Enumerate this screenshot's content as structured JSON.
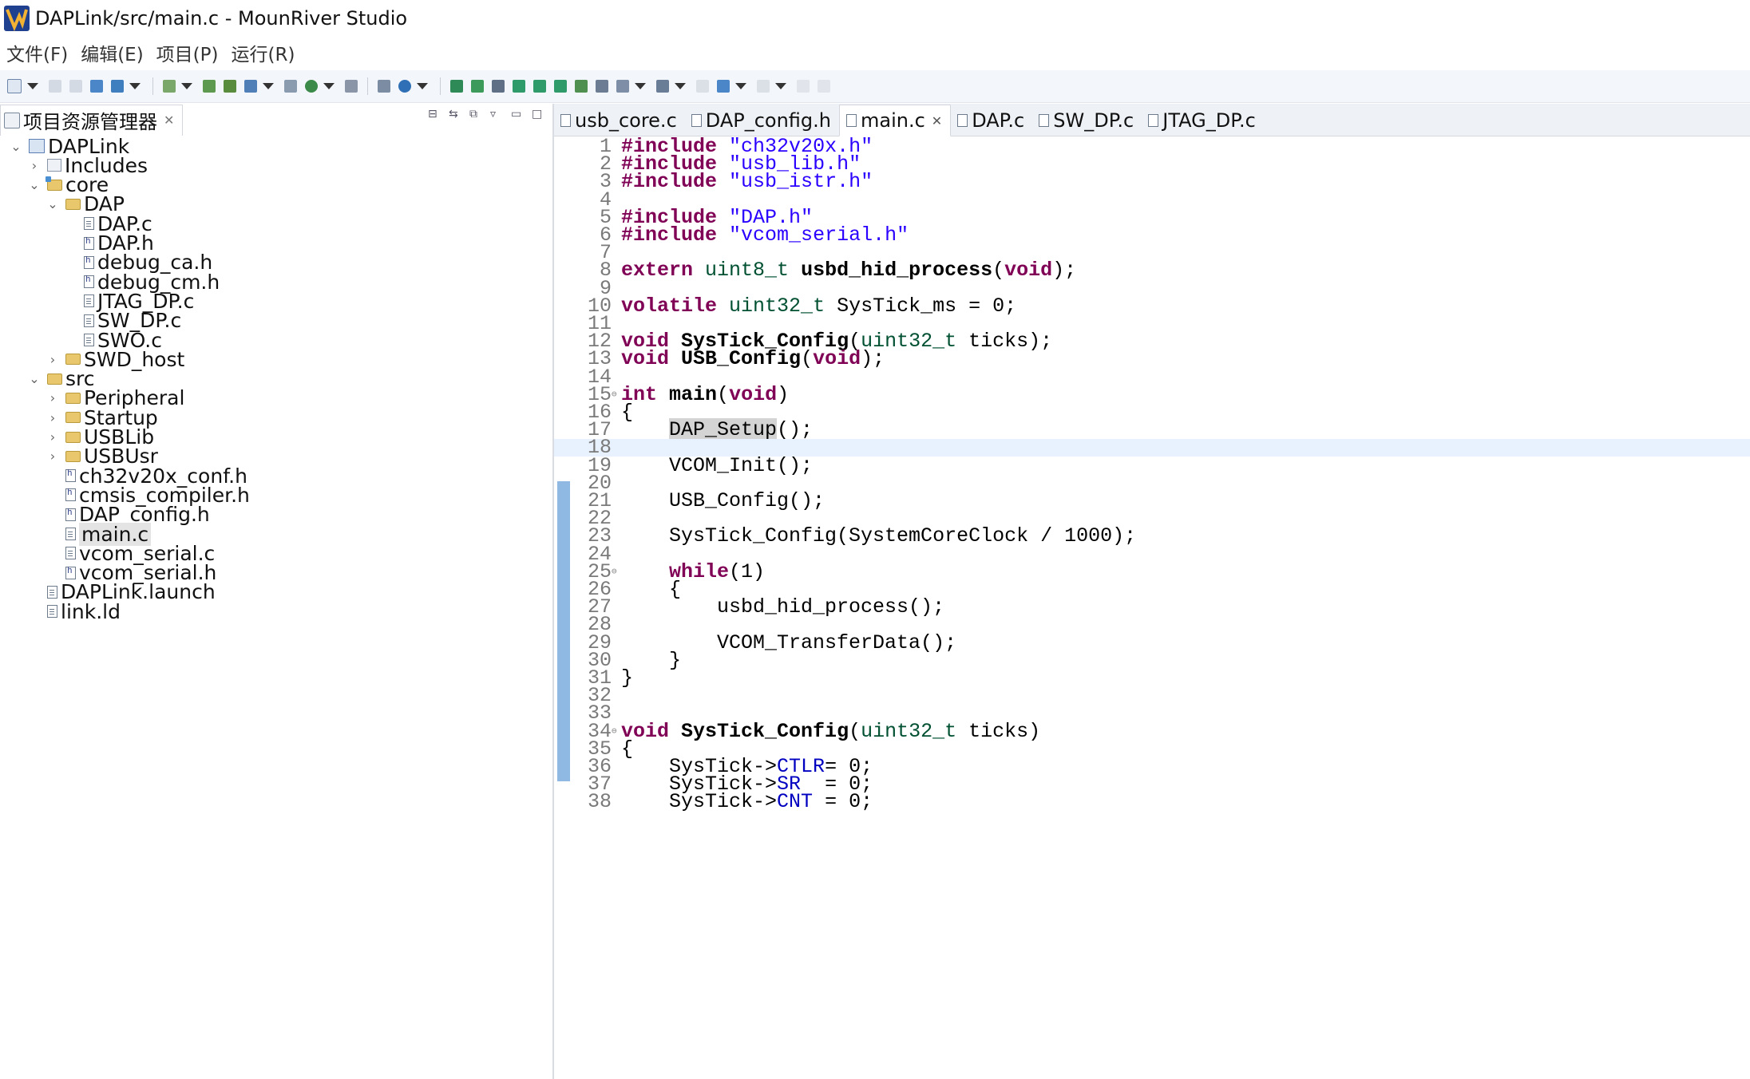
{
  "window": {
    "title": "DAPLink/src/main.c - MounRiver Studio"
  },
  "menu": [
    "文件(F)",
    "编辑(E)",
    "项目(P)",
    "运行(R)"
  ],
  "explorer": {
    "title": "项目资源管理器",
    "tree": [
      {
        "label": "DAPLink",
        "depth": 0,
        "twisty": "v",
        "icon": "project"
      },
      {
        "label": "Includes",
        "depth": 1,
        "twisty": ">",
        "icon": "include"
      },
      {
        "label": "core",
        "depth": 1,
        "twisty": "v",
        "icon": "srcfolder"
      },
      {
        "label": "DAP",
        "depth": 2,
        "twisty": "v",
        "icon": "folder"
      },
      {
        "label": "DAP.c",
        "depth": 3,
        "twisty": "",
        "icon": "file"
      },
      {
        "label": "DAP.h",
        "depth": 3,
        "twisty": "",
        "icon": "hfile"
      },
      {
        "label": "debug_ca.h",
        "depth": 3,
        "twisty": "",
        "icon": "hfile"
      },
      {
        "label": "debug_cm.h",
        "depth": 3,
        "twisty": "",
        "icon": "hfile"
      },
      {
        "label": "JTAG_DP.c",
        "depth": 3,
        "twisty": "",
        "icon": "file"
      },
      {
        "label": "SW_DP.c",
        "depth": 3,
        "twisty": "",
        "icon": "file"
      },
      {
        "label": "SWO.c",
        "depth": 3,
        "twisty": "",
        "icon": "file"
      },
      {
        "label": "SWD_host",
        "depth": 2,
        "twisty": ">",
        "icon": "folder"
      },
      {
        "label": "src",
        "depth": 1,
        "twisty": "v",
        "icon": "folder"
      },
      {
        "label": "Peripheral",
        "depth": 2,
        "twisty": ">",
        "icon": "folder"
      },
      {
        "label": "Startup",
        "depth": 2,
        "twisty": ">",
        "icon": "folder"
      },
      {
        "label": "USBLib",
        "depth": 2,
        "twisty": ">",
        "icon": "folder"
      },
      {
        "label": "USBUsr",
        "depth": 2,
        "twisty": ">",
        "icon": "folder"
      },
      {
        "label": "ch32v20x_conf.h",
        "depth": 2,
        "twisty": "",
        "icon": "hfile"
      },
      {
        "label": "cmsis_compiler.h",
        "depth": 2,
        "twisty": "",
        "icon": "hfile"
      },
      {
        "label": "DAP_config.h",
        "depth": 2,
        "twisty": "",
        "icon": "hfile"
      },
      {
        "label": "main.c",
        "depth": 2,
        "twisty": "",
        "icon": "file",
        "selected": true
      },
      {
        "label": "vcom_serial.c",
        "depth": 2,
        "twisty": "",
        "icon": "file"
      },
      {
        "label": "vcom_serial.h",
        "depth": 2,
        "twisty": "",
        "icon": "hfile"
      },
      {
        "label": "DAPLink.launch",
        "depth": 1,
        "twisty": "",
        "icon": "file"
      },
      {
        "label": "link.ld",
        "depth": 1,
        "twisty": "",
        "icon": "file"
      }
    ]
  },
  "editor": {
    "tabs": [
      {
        "label": "usb_core.c",
        "active": false
      },
      {
        "label": "DAP_config.h",
        "active": false
      },
      {
        "label": "main.c",
        "active": true
      },
      {
        "label": "DAP.c",
        "active": false
      },
      {
        "label": "SW_DP.c",
        "active": false
      },
      {
        "label": "JTAG_DP.c",
        "active": false
      }
    ],
    "current_line": 18,
    "lines": [
      [
        [
          "kw",
          "#include"
        ],
        [
          "t",
          " "
        ],
        [
          "str",
          "\"ch32v20x.h\""
        ]
      ],
      [
        [
          "kw",
          "#include"
        ],
        [
          "t",
          " "
        ],
        [
          "str",
          "\"usb_lib.h\""
        ]
      ],
      [
        [
          "kw",
          "#include"
        ],
        [
          "t",
          " "
        ],
        [
          "str",
          "\"usb_istr.h\""
        ]
      ],
      [],
      [
        [
          "kw",
          "#include"
        ],
        [
          "t",
          " "
        ],
        [
          "str",
          "\"DAP.h\""
        ]
      ],
      [
        [
          "kw",
          "#include"
        ],
        [
          "t",
          " "
        ],
        [
          "str",
          "\"vcom_serial.h\""
        ]
      ],
      [],
      [
        [
          "kw",
          "extern"
        ],
        [
          "t",
          " "
        ],
        [
          "type",
          "uint8_t"
        ],
        [
          "t",
          " "
        ],
        [
          "fn",
          "usbd_hid_process"
        ],
        [
          "t",
          "("
        ],
        [
          "kw",
          "void"
        ],
        [
          "t",
          ");"
        ]
      ],
      [],
      [
        [
          "kw",
          "volatile"
        ],
        [
          "t",
          " "
        ],
        [
          "type",
          "uint32_t"
        ],
        [
          "t",
          " SysTick_ms = 0;"
        ]
      ],
      [],
      [
        [
          "kw",
          "void"
        ],
        [
          "t",
          " "
        ],
        [
          "fn",
          "SysTick_Config"
        ],
        [
          "t",
          "("
        ],
        [
          "type",
          "uint32_t"
        ],
        [
          "t",
          " ticks);"
        ]
      ],
      [
        [
          "kw",
          "void"
        ],
        [
          "t",
          " "
        ],
        [
          "fn",
          "USB_Config"
        ],
        [
          "t",
          "("
        ],
        [
          "kw",
          "void"
        ],
        [
          "t",
          ");"
        ]
      ],
      [],
      [
        [
          "kw",
          "int"
        ],
        [
          "t",
          " "
        ],
        [
          "fn",
          "main"
        ],
        [
          "t",
          "("
        ],
        [
          "kw",
          "void"
        ],
        [
          "t",
          ")"
        ]
      ],
      [
        [
          "t",
          "{"
        ]
      ],
      [
        [
          "t",
          "    "
        ],
        [
          "hl",
          "DAP_Setup"
        ],
        [
          "t",
          "();"
        ]
      ],
      [],
      [
        [
          "t",
          "    VCOM_Init();"
        ]
      ],
      [],
      [
        [
          "t",
          "    USB_Config();"
        ]
      ],
      [],
      [
        [
          "t",
          "    SysTick_Config(SystemCoreClock / 1000);"
        ]
      ],
      [],
      [
        [
          "t",
          "    "
        ],
        [
          "kw",
          "while"
        ],
        [
          "t",
          "(1)"
        ]
      ],
      [
        [
          "t",
          "    {"
        ]
      ],
      [
        [
          "t",
          "        usbd_hid_process();"
        ]
      ],
      [],
      [
        [
          "t",
          "        VCOM_TransferData();"
        ]
      ],
      [
        [
          "t",
          "    }"
        ]
      ],
      [
        [
          "t",
          "}"
        ]
      ],
      [],
      [],
      [
        [
          "kw",
          "void"
        ],
        [
          "t",
          " "
        ],
        [
          "fn",
          "SysTick_Config"
        ],
        [
          "t",
          "("
        ],
        [
          "type",
          "uint32_t"
        ],
        [
          "t",
          " ticks)"
        ]
      ],
      [
        [
          "t",
          "{"
        ]
      ],
      [
        [
          "t",
          "    SysTick->"
        ],
        [
          "field",
          "CTLR"
        ],
        [
          "t",
          "= 0;"
        ]
      ],
      [
        [
          "t",
          "    SysTick->"
        ],
        [
          "field",
          "SR"
        ],
        [
          "t",
          "  = 0;"
        ]
      ],
      [
        [
          "t",
          "    SysTick->"
        ],
        [
          "field",
          "CNT"
        ],
        [
          "t",
          " = 0;"
        ]
      ]
    ],
    "fold_markers": [
      15,
      25,
      34
    ]
  }
}
